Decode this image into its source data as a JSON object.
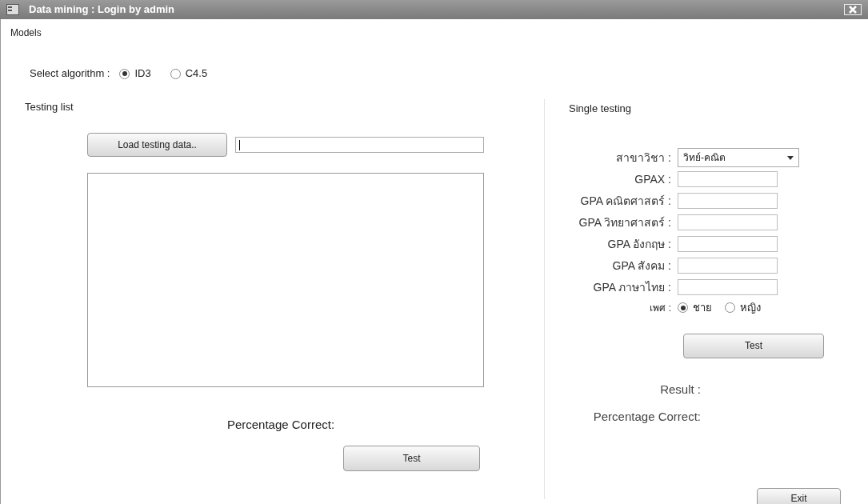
{
  "window": {
    "title": "Data mining : Login by admin"
  },
  "menu": [
    "Models"
  ],
  "algorithm": {
    "label": "Select algorithm :",
    "options": [
      {
        "label": "ID3",
        "selected": true
      },
      {
        "label": "C4.5",
        "selected": false
      }
    ]
  },
  "testing_list": {
    "title": "Testing list",
    "load_button": "Load testing data..",
    "percentage_label": "Percentage Correct:",
    "test_button": "Test"
  },
  "single_testing": {
    "title": "Single testing",
    "fields": [
      {
        "kind": "dropdown",
        "label": "สาขาวิชา :",
        "value": "วิทย์-คณิต"
      },
      {
        "kind": "text",
        "label": "GPAX :"
      },
      {
        "kind": "text",
        "label": "GPA คณิตศาสตร์ :"
      },
      {
        "kind": "text",
        "label": "GPA วิทยาศาสตร์ :"
      },
      {
        "kind": "text",
        "label": "GPA อังกฤษ :"
      },
      {
        "kind": "text",
        "label": "GPA สังคม :"
      },
      {
        "kind": "text",
        "label": "GPA ภาษาไทย :"
      }
    ],
    "gender": {
      "label": "เพศ :",
      "options": [
        {
          "label": "ชาย",
          "selected": true
        },
        {
          "label": "หญิง",
          "selected": false
        }
      ]
    },
    "test_button": "Test",
    "result_label": "Result :",
    "percentage_label": "Percentage Correct:"
  },
  "exit_button": "Exit"
}
